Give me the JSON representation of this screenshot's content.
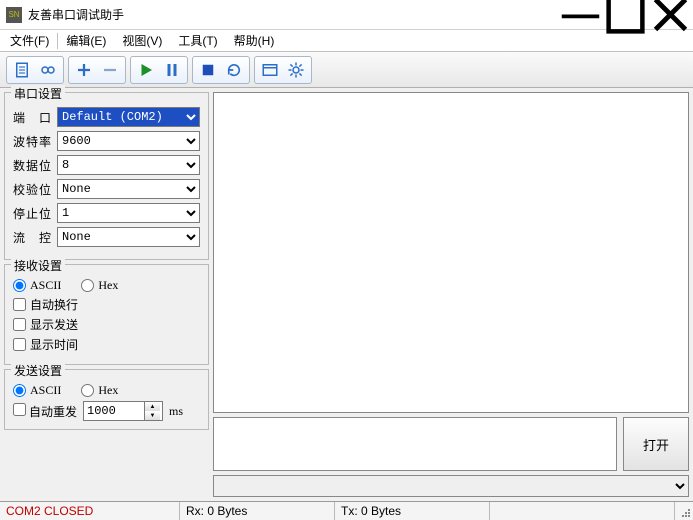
{
  "window": {
    "title": "友善串口调试助手",
    "icon_label": "SN"
  },
  "menu": {
    "file": "文件(F)",
    "edit": "编辑(E)",
    "view": "视图(V)",
    "tools": "工具(T)",
    "help": "帮助(H)"
  },
  "serial_settings": {
    "legend": "串口设置",
    "port_label": "端　口",
    "port_value": "Default (COM2)",
    "baud_label": "波特率",
    "baud_value": "9600",
    "databits_label": "数据位",
    "databits_value": "8",
    "parity_label": "校验位",
    "parity_value": "None",
    "stopbits_label": "停止位",
    "stopbits_value": "1",
    "flow_label": "流　控",
    "flow_value": "None"
  },
  "recv_settings": {
    "legend": "接收设置",
    "ascii_label": "ASCII",
    "hex_label": "Hex",
    "auto_wrap_label": "自动换行",
    "show_send_label": "显示发送",
    "show_time_label": "显示时间"
  },
  "send_settings": {
    "legend": "发送设置",
    "ascii_label": "ASCII",
    "hex_label": "Hex",
    "auto_resend_label": "自动重发",
    "interval_value": "1000",
    "interval_unit": "ms"
  },
  "actions": {
    "open_label": "打开"
  },
  "status": {
    "port": "COM2 CLOSED",
    "rx": "Rx: 0 Bytes",
    "tx": "Tx: 0 Bytes"
  }
}
